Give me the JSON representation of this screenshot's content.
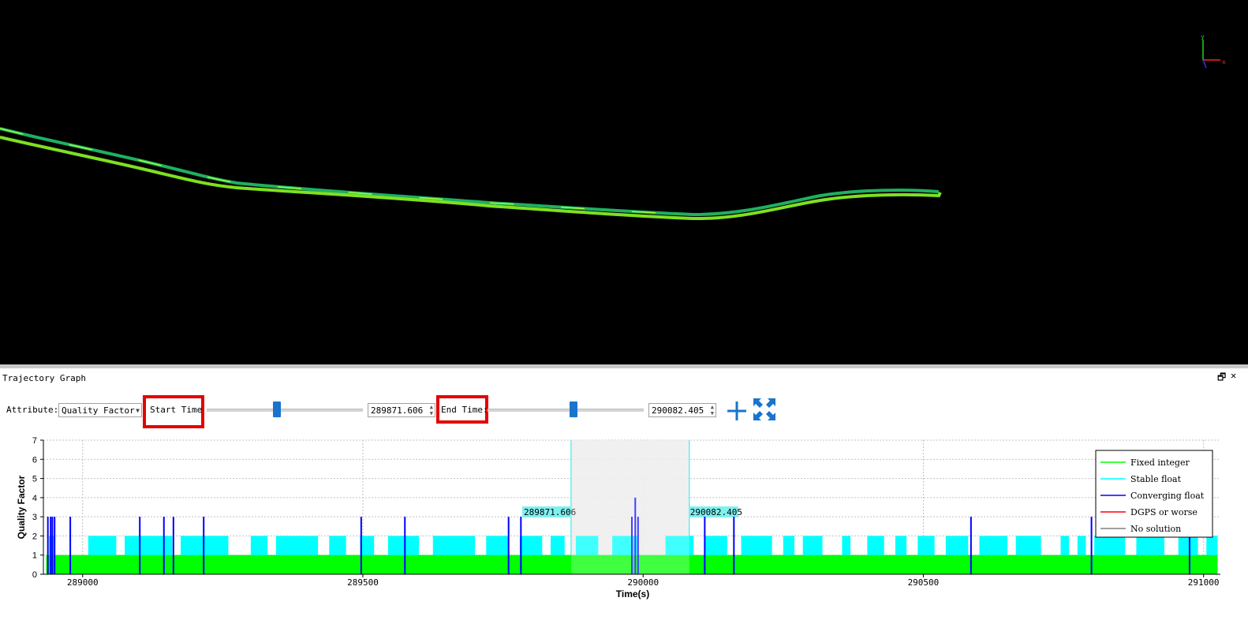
{
  "viewer": {
    "axis_triad": {
      "x_label": "x",
      "y_label": "y",
      "colors": {
        "x": "#ff2020",
        "y": "#20d020",
        "z": "#3030ff"
      }
    }
  },
  "panel": {
    "title": "Trajectory Graph",
    "restore_glyph": "🗗",
    "close_glyph": "✕"
  },
  "controls": {
    "attribute_label": "Attribute:",
    "attribute_value": "Quality Factor",
    "start_time_label": "Start Time",
    "start_time_value": "289871.606",
    "start_slider_level": 0.45,
    "end_time_label": "End Time:",
    "end_time_value": "290082.405",
    "end_slider_level": 0.55,
    "add_icon": "plus-icon",
    "fit_icon": "expand-icon",
    "accent": "#1874cd",
    "highlight_color": "#e30000"
  },
  "chart_data": {
    "type": "bar",
    "xlabel": "Time(s)",
    "ylabel": "Quality Factor",
    "xlim": [
      288930,
      291030
    ],
    "ylim": [
      0,
      7
    ],
    "x_ticks": [
      289000,
      289500,
      290000,
      290500,
      291000
    ],
    "y_ticks": [
      0,
      1,
      2,
      3,
      4,
      5,
      6,
      7
    ],
    "grid": true,
    "legend_position": "right",
    "selection": {
      "start": 289871.606,
      "end": 290082.405,
      "start_label": "289871.606",
      "end_label": "290082.405"
    },
    "series": [
      {
        "name": "Fixed integer",
        "color": "#00ff00",
        "value": 1,
        "spans": [
          [
            288935,
            291025
          ]
        ]
      },
      {
        "name": "Stable float",
        "color": "#00ffff",
        "value": 2,
        "spans": [
          [
            288940,
            288950
          ],
          [
            289010,
            289060
          ],
          [
            289075,
            289160
          ],
          [
            289175,
            289260
          ],
          [
            289300,
            289330
          ],
          [
            289345,
            289420
          ],
          [
            289440,
            289470
          ],
          [
            289495,
            289520
          ],
          [
            289545,
            289600
          ],
          [
            289625,
            289700
          ],
          [
            289720,
            289760
          ],
          [
            289780,
            289820
          ],
          [
            289835,
            289860
          ],
          [
            289880,
            289920
          ],
          [
            289945,
            289990
          ],
          [
            290040,
            290090
          ],
          [
            290110,
            290150
          ],
          [
            290175,
            290230
          ],
          [
            290250,
            290270
          ],
          [
            290285,
            290320
          ],
          [
            290355,
            290370
          ],
          [
            290400,
            290430
          ],
          [
            290450,
            290470
          ],
          [
            290490,
            290520
          ],
          [
            290540,
            290580
          ],
          [
            290600,
            290650
          ],
          [
            290665,
            290710
          ],
          [
            290745,
            290760
          ],
          [
            290775,
            290790
          ],
          [
            290805,
            290860
          ],
          [
            290880,
            290930
          ],
          [
            290955,
            290990
          ],
          [
            291005,
            291025
          ]
        ]
      },
      {
        "name": "Converging float",
        "color": "#0000ff",
        "value": 3,
        "spikes": [
          [
            288938,
            3
          ],
          [
            288943,
            3
          ],
          [
            288946,
            3
          ],
          [
            288950,
            3
          ],
          [
            288978,
            3
          ],
          [
            289102,
            3
          ],
          [
            289145,
            3
          ],
          [
            289162,
            3
          ],
          [
            289216,
            3
          ],
          [
            289497,
            3
          ],
          [
            289575,
            3
          ],
          [
            289760,
            3
          ],
          [
            289782,
            3
          ],
          [
            289980,
            3
          ],
          [
            289986,
            4
          ],
          [
            289991,
            3
          ],
          [
            290110,
            3
          ],
          [
            290162,
            3
          ],
          [
            290585,
            3
          ],
          [
            290800,
            3
          ],
          [
            290975,
            3
          ]
        ]
      },
      {
        "name": "DGPS or worse",
        "color": "#ff0000",
        "value": 4,
        "spikes": []
      },
      {
        "name": "No solution",
        "color": "#808080",
        "value": 0,
        "spikes": []
      }
    ]
  }
}
